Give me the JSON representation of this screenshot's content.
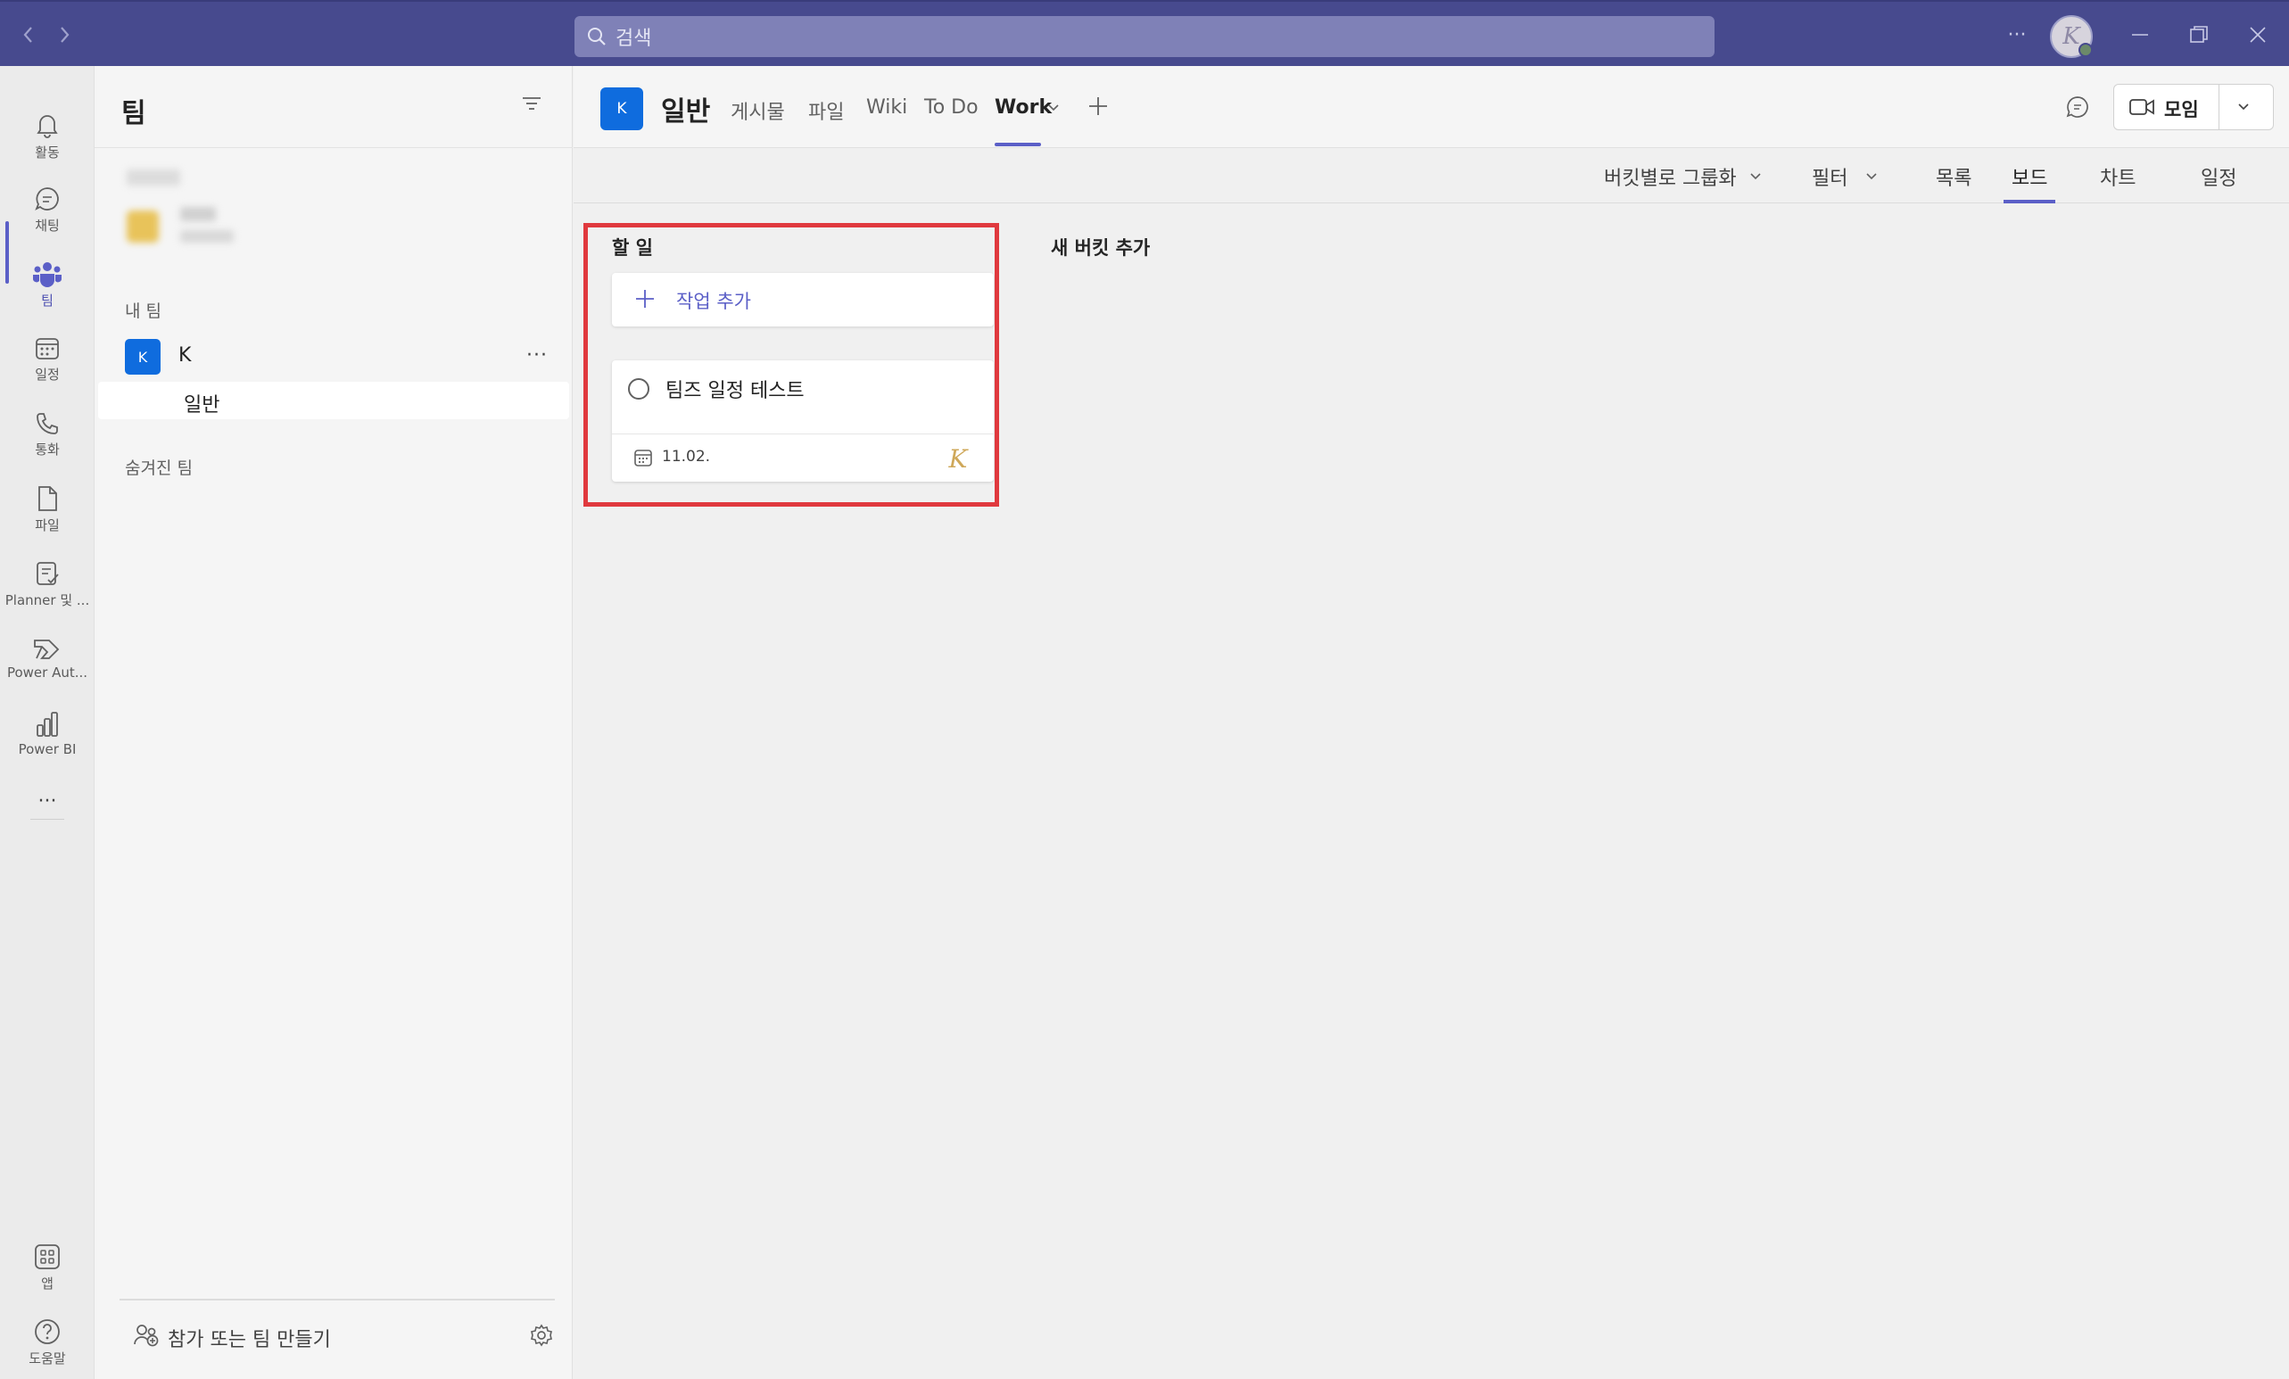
{
  "titlebar": {
    "search_placeholder": "검색",
    "more_label": "···"
  },
  "rail": {
    "items": [
      {
        "label": "활동",
        "icon": "bell-icon"
      },
      {
        "label": "채팅",
        "icon": "chat-icon"
      },
      {
        "label": "팀",
        "icon": "teams-icon"
      },
      {
        "label": "일정",
        "icon": "calendar-icon"
      },
      {
        "label": "통화",
        "icon": "phone-icon"
      },
      {
        "label": "파일",
        "icon": "file-icon"
      },
      {
        "label": "Planner 및 ...",
        "icon": "planner-icon"
      },
      {
        "label": "Power Aut...",
        "icon": "power-automate-icon"
      },
      {
        "label": "Power BI",
        "icon": "power-bi-icon"
      },
      {
        "label": "앱",
        "icon": "apps-icon"
      },
      {
        "label": "도움말",
        "icon": "help-icon"
      }
    ],
    "more_label": "···"
  },
  "teams_panel": {
    "title": "팀",
    "my_teams_label": "내 팀",
    "team": {
      "avatar": "K",
      "name": "K",
      "more": "···"
    },
    "channel": "일반",
    "hidden_teams_label": "숨겨진 팀",
    "join_create_label": "참가 또는 팀 만들기"
  },
  "header": {
    "channel_avatar": "K",
    "channel_title": "일반",
    "tabs": [
      "게시물",
      "파일",
      "Wiki",
      "To Do",
      "Work"
    ],
    "active_tab": "Work",
    "meet_label": "모임"
  },
  "planner": {
    "group_by_label": "버킷별로 그룹화",
    "filter_label": "필터",
    "views": [
      "목록",
      "보드",
      "차트",
      "일정"
    ],
    "active_view": "보드"
  },
  "board": {
    "bucket_title": "할 일",
    "add_task_label": "작업 추가",
    "task": {
      "title": "팀즈 일정 테스트",
      "due_date": "11.02.",
      "assignee_initial": "K"
    },
    "new_bucket_label": "새 버킷 추가",
    "highlight_color": "#e0393e"
  }
}
